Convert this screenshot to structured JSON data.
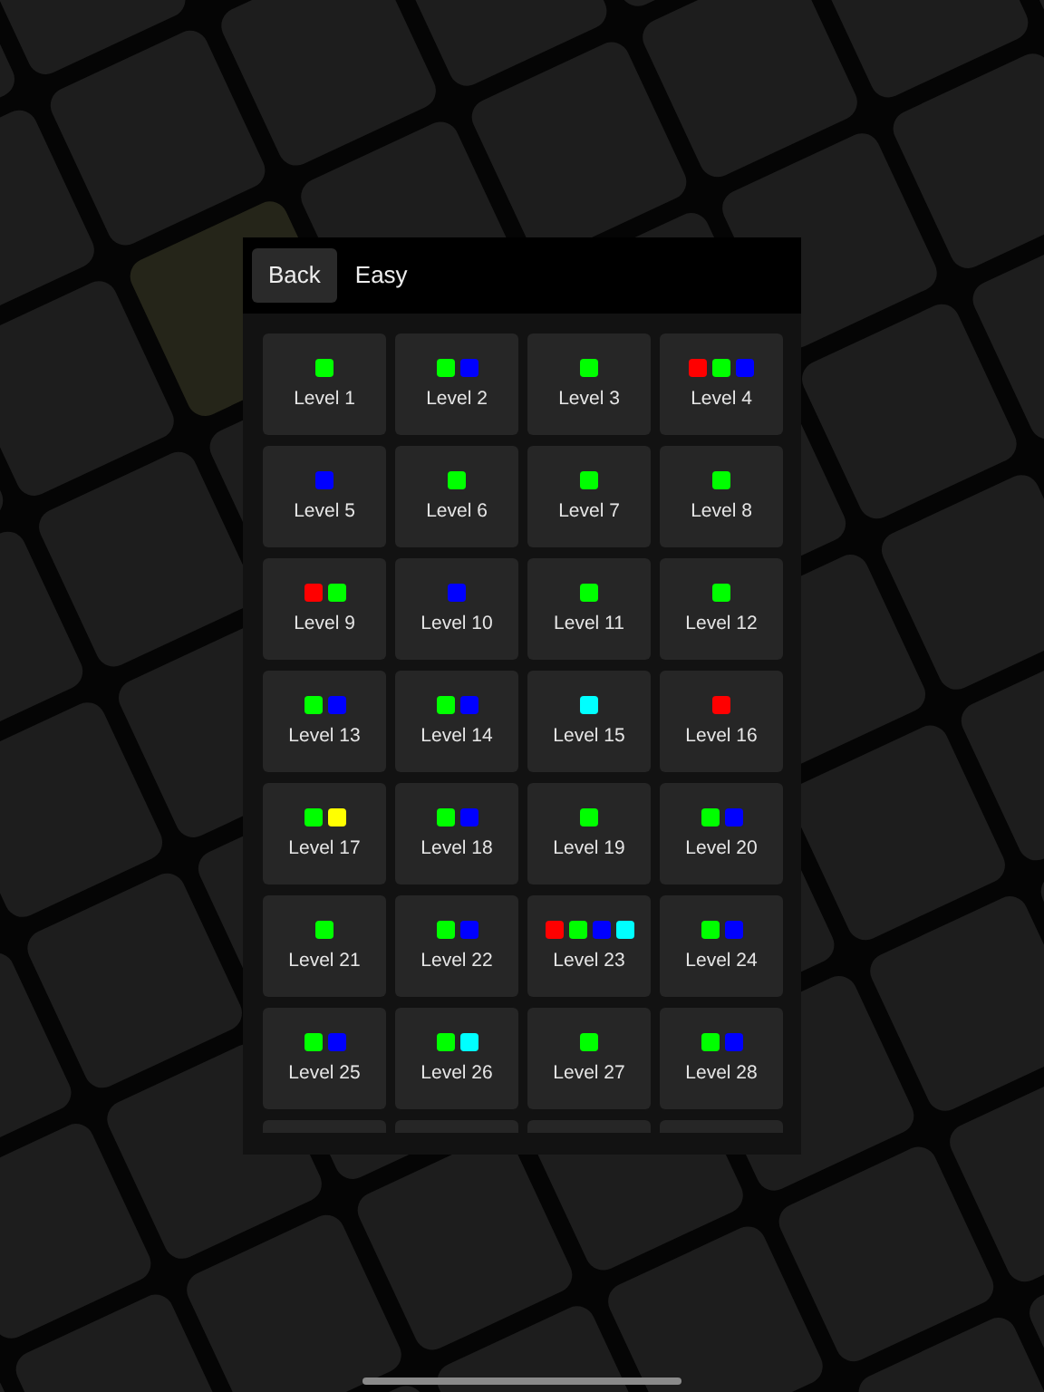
{
  "header": {
    "back_button": "Back",
    "title": "Easy"
  },
  "levels": [
    {
      "label": "Level 1",
      "dots": [
        {
          "color": "#00ff00"
        }
      ]
    },
    {
      "label": "Level 2",
      "dots": [
        {
          "color": "#00ff00"
        },
        {
          "color": "#0000ff"
        }
      ]
    },
    {
      "label": "Level 3",
      "dots": [
        {
          "color": "#00ff00"
        }
      ]
    },
    {
      "label": "Level 4",
      "dots": [
        {
          "color": "#ff0000"
        },
        {
          "color": "#00ff00"
        },
        {
          "color": "#0000ff"
        }
      ]
    },
    {
      "label": "Level 5",
      "dots": [
        {
          "color": "#0000ff"
        }
      ]
    },
    {
      "label": "Level 6",
      "dots": [
        {
          "color": "#00ff00"
        }
      ]
    },
    {
      "label": "Level 7",
      "dots": [
        {
          "color": "#00ff00"
        }
      ]
    },
    {
      "label": "Level 8",
      "dots": [
        {
          "color": "#00ff00"
        }
      ]
    },
    {
      "label": "Level 9",
      "dots": [
        {
          "color": "#ff0000"
        },
        {
          "color": "#00ff00"
        }
      ]
    },
    {
      "label": "Level 10",
      "dots": [
        {
          "color": "#0000ff"
        }
      ]
    },
    {
      "label": "Level 11",
      "dots": [
        {
          "color": "#00ff00"
        }
      ]
    },
    {
      "label": "Level 12",
      "dots": [
        {
          "color": "#00ff00"
        }
      ]
    },
    {
      "label": "Level 13",
      "dots": [
        {
          "color": "#00ff00"
        },
        {
          "color": "#0000ff"
        }
      ]
    },
    {
      "label": "Level 14",
      "dots": [
        {
          "color": "#00ff00"
        },
        {
          "color": "#0000ff"
        }
      ]
    },
    {
      "label": "Level 15",
      "dots": [
        {
          "color": "#00ffff"
        }
      ]
    },
    {
      "label": "Level 16",
      "dots": [
        {
          "color": "#ff0000"
        }
      ]
    },
    {
      "label": "Level 17",
      "dots": [
        {
          "color": "#00ff00"
        },
        {
          "color": "#ffff00"
        }
      ]
    },
    {
      "label": "Level 18",
      "dots": [
        {
          "color": "#00ff00"
        },
        {
          "color": "#0000ff"
        }
      ]
    },
    {
      "label": "Level 19",
      "dots": [
        {
          "color": "#00ff00"
        }
      ]
    },
    {
      "label": "Level 20",
      "dots": [
        {
          "color": "#00ff00"
        },
        {
          "color": "#0000ff"
        }
      ]
    },
    {
      "label": "Level 21",
      "dots": [
        {
          "color": "#00ff00"
        }
      ]
    },
    {
      "label": "Level 22",
      "dots": [
        {
          "color": "#00ff00"
        },
        {
          "color": "#0000ff"
        }
      ]
    },
    {
      "label": "Level 23",
      "dots": [
        {
          "color": "#ff0000"
        },
        {
          "color": "#00ff00"
        },
        {
          "color": "#0000ff"
        },
        {
          "color": "#00ffff"
        }
      ]
    },
    {
      "label": "Level 24",
      "dots": [
        {
          "color": "#00ff00"
        },
        {
          "color": "#0000ff"
        }
      ]
    },
    {
      "label": "Level 25",
      "dots": [
        {
          "color": "#00ff00"
        },
        {
          "color": "#0000ff"
        }
      ]
    },
    {
      "label": "Level 26",
      "dots": [
        {
          "color": "#00ff00"
        },
        {
          "color": "#00ffff"
        }
      ]
    },
    {
      "label": "Level 27",
      "dots": [
        {
          "color": "#00ff00"
        }
      ]
    },
    {
      "label": "Level 28",
      "dots": [
        {
          "color": "#00ff00"
        },
        {
          "color": "#0000ff"
        }
      ]
    }
  ]
}
